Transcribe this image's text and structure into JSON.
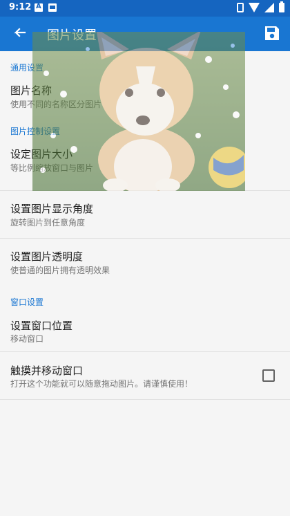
{
  "status_bar": {
    "time": "9:12",
    "icons": [
      "notification-a-icon",
      "notification-image-icon",
      "vibrate-icon",
      "wifi-icon",
      "signal-icon",
      "battery-icon"
    ]
  },
  "app_bar": {
    "title": "图片设置",
    "back_icon": "arrow-back-icon",
    "save_icon": "save-icon",
    "background_color": "#1976d2",
    "status_color": "#1565c0"
  },
  "sections": [
    {
      "header": "通用设置",
      "items": [
        {
          "title": "图片名称",
          "summary": "使用不同的名称区分图片"
        }
      ]
    },
    {
      "header": "图片控制设置",
      "items": [
        {
          "title": "设定图片大小",
          "summary": "等比例缩放窗口与图片"
        },
        {
          "title": "设置图片显示角度",
          "summary": "旋转图片到任意角度"
        },
        {
          "title": "设置图片透明度",
          "summary": "使普通的图片拥有透明效果"
        }
      ]
    },
    {
      "header": "窗口设置",
      "items": [
        {
          "title": "设置窗口位置",
          "summary": "移动窗口"
        },
        {
          "title": "触摸并移动窗口",
          "summary": "打开这个功能就可以随意拖动图片。请谨慎使用！",
          "checked": false
        }
      ]
    }
  ],
  "overlay": {
    "description_icon": "corgi-puppy-image",
    "opacity": 0.55
  }
}
